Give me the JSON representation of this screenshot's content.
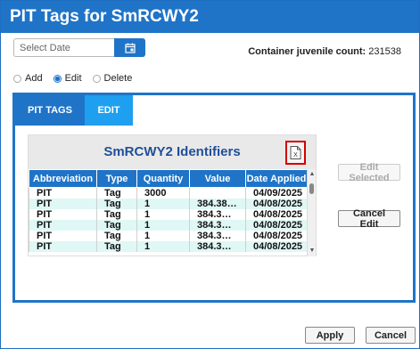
{
  "window": {
    "title": "PIT Tags for SmRCWY2"
  },
  "date_picker": {
    "placeholder": "Select Date",
    "icon": "calendar-icon"
  },
  "container": {
    "label": "Container juvenile count:",
    "value": "231538"
  },
  "mode": {
    "options": [
      {
        "label": "Add",
        "checked": false
      },
      {
        "label": "Edit",
        "checked": true
      },
      {
        "label": "Delete",
        "checked": false
      }
    ]
  },
  "tabs": [
    {
      "label": "PIT TAGS",
      "active": true
    },
    {
      "label": "EDIT",
      "active": false
    }
  ],
  "grid": {
    "title": "SmRCWY2 Identifiers",
    "export_icon": "excel-export-icon",
    "columns": [
      "Abbreviation",
      "Type",
      "Quantity",
      "Value",
      "Date Applied"
    ],
    "rows": [
      [
        "PIT",
        "Tag",
        "3000",
        "",
        "04/09/2025"
      ],
      [
        "PIT",
        "Tag",
        "1",
        "384.38…",
        "04/08/2025"
      ],
      [
        "PIT",
        "Tag",
        "1",
        "384.3…",
        "04/08/2025"
      ],
      [
        "PIT",
        "Tag",
        "1",
        "384.3…",
        "04/08/2025"
      ],
      [
        "PIT",
        "Tag",
        "1",
        "384.3…",
        "04/08/2025"
      ],
      [
        "PIT",
        "Tag",
        "1",
        "384.3…",
        "04/08/2025"
      ]
    ]
  },
  "buttons": {
    "edit_selected": "Edit Selected",
    "cancel_edit": "Cancel Edit",
    "apply": "Apply",
    "cancel": "Cancel"
  },
  "colors": {
    "accent": "#1f74c8",
    "highlight": "#d40000",
    "row_alt": "#dff7f5"
  }
}
